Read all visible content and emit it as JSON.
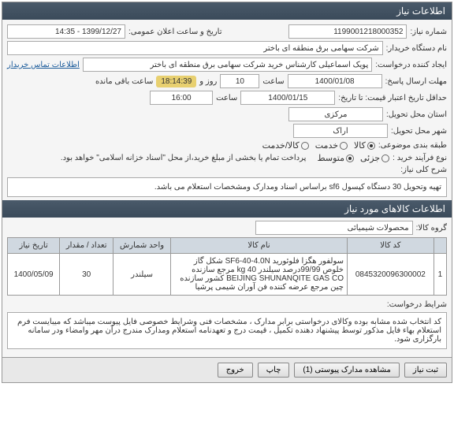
{
  "header": {
    "title": "اطلاعات نیاز"
  },
  "fields": {
    "need_number_label": "شماره نیاز:",
    "need_number": "1199001218000352",
    "public_announce_label": "تاریخ و ساعت اعلان عمومی:",
    "public_announce": "1399/12/27 - 14:35",
    "buyer_org_label": "نام دستگاه خریدار:",
    "buyer_org": "شرکت سهامی برق منطقه ای باختر",
    "creator_label": "ایجاد کننده درخواست:",
    "creator": "پویک اسماعیلی کارشناس خرید شرکت سهامی برق منطقه ای باختر",
    "contact_link": "اطلاعات تماس خریدار",
    "deadline_label": "مهلت ارسال پاسخ:",
    "to_date_label": "تا تاریخ:",
    "deadline_date": "1400/01/08",
    "hour_label": "ساعت",
    "deadline_hour": "10",
    "day_label": "روز و",
    "remaining_time": "18:14:39",
    "remaining_label": "ساعت باقی مانده",
    "min_credit_label": "حداقل تاریخ اعتبار قیمت: تا تاریخ:",
    "min_credit_date": "1400/01/15",
    "min_credit_hour": "16:00",
    "delivery_province_label": "استان محل تحویل:",
    "delivery_province": "مرکزی",
    "delivery_city_label": "شهر محل تحویل:",
    "delivery_city": "اراک",
    "budget_group_label": "طبقه بندی موضوعی:",
    "purchase_process_label": "نوع فرآیند خرید :",
    "budget_note": "پرداخت تمام یا بخشی از مبلغ خرید،از محل \"اسناد خزانه اسلامی\" خواهد بود.",
    "radio_goods": "کالا",
    "radio_service": "خدمت",
    "radio_goods_service": "کالا/خدمت",
    "radio_low": "جزئی",
    "radio_medium": "متوسط"
  },
  "desc": {
    "label": "شرح کلی نیاز:",
    "text": "تهیه وتحویل 30 دستگاه کپسول sf6  براساس اسناد ومدارک ومشخصات استعلام می باشد."
  },
  "goods_header": "اطلاعات کالاهای مورد نیاز",
  "goods_group_label": "گروه کالا:",
  "goods_group": "محصولات شیمیائی",
  "table": {
    "headers": [
      "",
      "کد کالا",
      "نام کالا",
      "واحد شمارش",
      "تعداد / مقدار",
      "تاریخ نیاز"
    ],
    "row": {
      "idx": "1",
      "code": "0845320096300002",
      "name": "سولفور هگزا فلوئورید SF6-40-4.0N شکل گاز خلوص 99/99درصد سیلندر kg 40 مرجع سازنده BEIJING SHUNANQITE GAS CO کشور سازنده چین مرجع عرضه کننده فن آوران شیمی پرشیا",
      "unit": "سیلندر",
      "qty": "30",
      "date": "1400/05/09"
    }
  },
  "conditions": {
    "label": "شرایط درخواست:",
    "text": "کد انتخاب شده مشابه بوده وکالای درخواستی برابر مدارک ، مشخصات فنی وشرایط خصوصی فایل پیوست میباشد که میبایست فرم استعلام بهاء فایل مذکور توسط پیشنهاد دهنده تکمیل ، قیمت درج و تعهدنامه استعلام ومدارک مندرج درآن مهر وامضاء ودر سامانه بارگزاری شود."
  },
  "footer": {
    "submit": "ثبت نیاز",
    "attachments": "مشاهده مدارک پیوستی (1)",
    "print": "چاپ",
    "exit": "خروج"
  }
}
